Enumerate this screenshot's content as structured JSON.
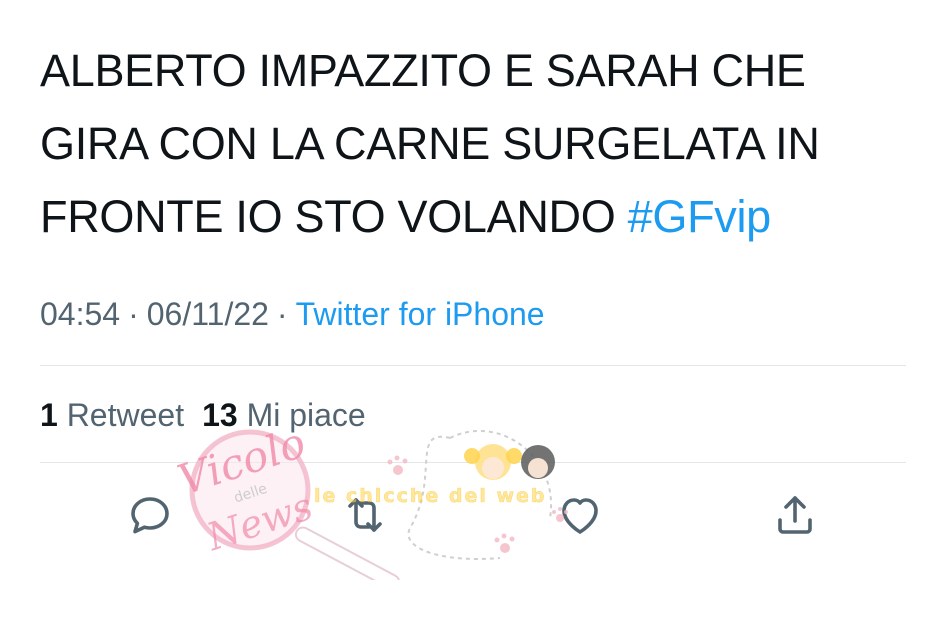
{
  "tweet": {
    "text_lines": [
      "ALBERTO IMPAZZITO E SARAH CHE",
      "GIRA CON LA CARNE SURGELATA IN",
      "FRONTE IO STO VOLANDO"
    ],
    "hashtag": "#GFvip"
  },
  "meta": {
    "time": "04:54",
    "separator": "·",
    "date": "06/11/22",
    "source": "Twitter for iPhone"
  },
  "stats": {
    "retweets_count": "1",
    "retweets_label": "Retweet",
    "likes_count": "13",
    "likes_label": "Mi piace"
  },
  "actions": [
    {
      "icon": "reply-icon"
    },
    {
      "icon": "retweet-icon"
    },
    {
      "icon": "like-icon"
    },
    {
      "icon": "share-icon"
    }
  ],
  "watermarks": {
    "left_text_1": "Vicolo",
    "left_text_2": "delle",
    "left_text_3": "News",
    "center_text": "le chicche del web"
  },
  "colors": {
    "text": "#0f1419",
    "secondary": "#536471",
    "accent": "#1d9bf0",
    "divider": "#e3e7ea"
  }
}
